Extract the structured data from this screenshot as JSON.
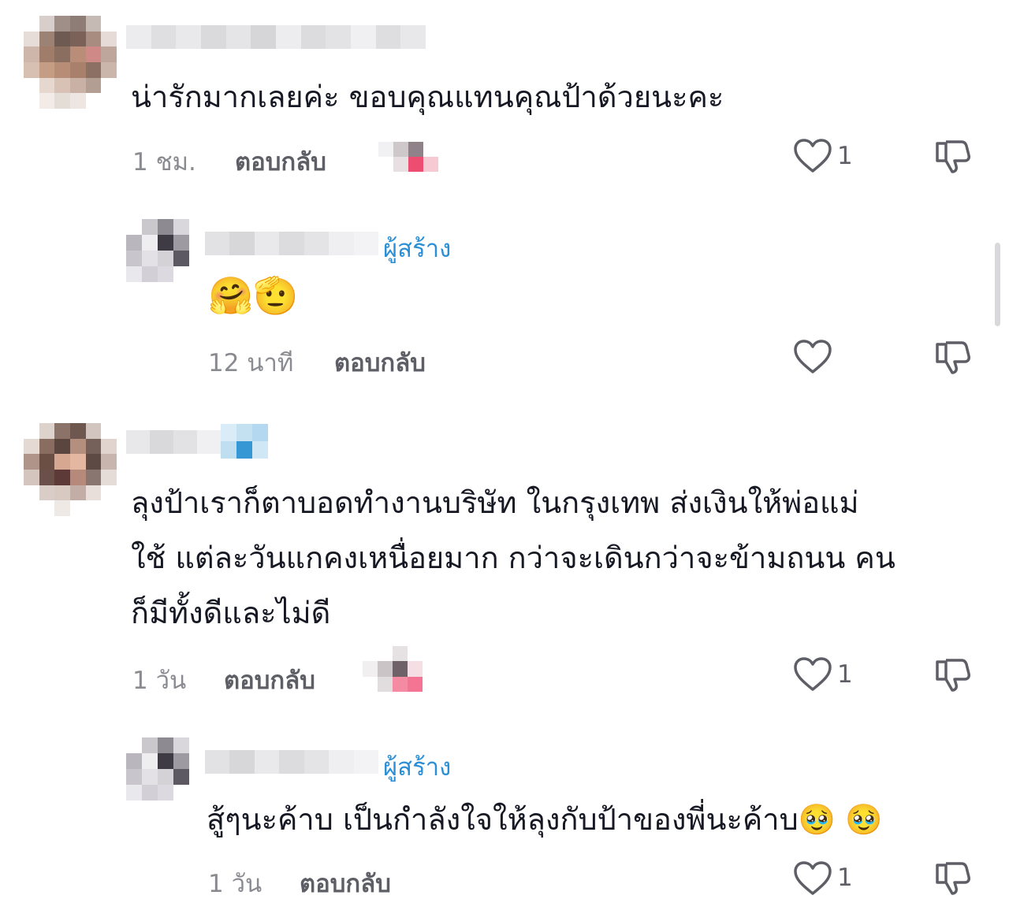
{
  "colors": {
    "text": "#161823",
    "muted": "#8a8b91",
    "reply": "#5e5f66",
    "creator": "#2b8fd6"
  },
  "comments": [
    {
      "text_lines": [
        "น่ารักมากเลยค่ะ ขอบคุณแทนคุณป้าด้วยนะคะ"
      ],
      "time": "1 ชม.",
      "reply_label": "ตอบกลับ",
      "like_count": "1",
      "icons": [
        "heart-outline-icon",
        "dislike-icon"
      ],
      "replies": [
        {
          "creator_tag": "ผู้สร้าง",
          "text": "🤗🫡",
          "time": "12 นาที",
          "reply_label": "ตอบกลับ",
          "like_count": ""
        }
      ]
    },
    {
      "text_lines": [
        "ลุงป้าเราก็ตาบอดทำงานบริษัท ในกรุงเทพ ส่งเงินให้พ่อแม่",
        "ใช้ แต่ละวันแกคงเหนื่อยมาก กว่าจะเดินกว่าจะข้ามถนน คน",
        "ก็มีทั้งดีและไม่ดี"
      ],
      "time": "1 วัน",
      "reply_label": "ตอบกลับ",
      "like_count": "1",
      "replies": [
        {
          "creator_tag": "ผู้สร้าง",
          "text": "สู้ๆนะค้าบ เป็นกำลังใจให้ลุงกับป้าของพี่นะค้าบ🥹 🥹",
          "time": "1 วัน",
          "reply_label": "ตอบกลับ",
          "like_count": "1"
        }
      ]
    }
  ]
}
